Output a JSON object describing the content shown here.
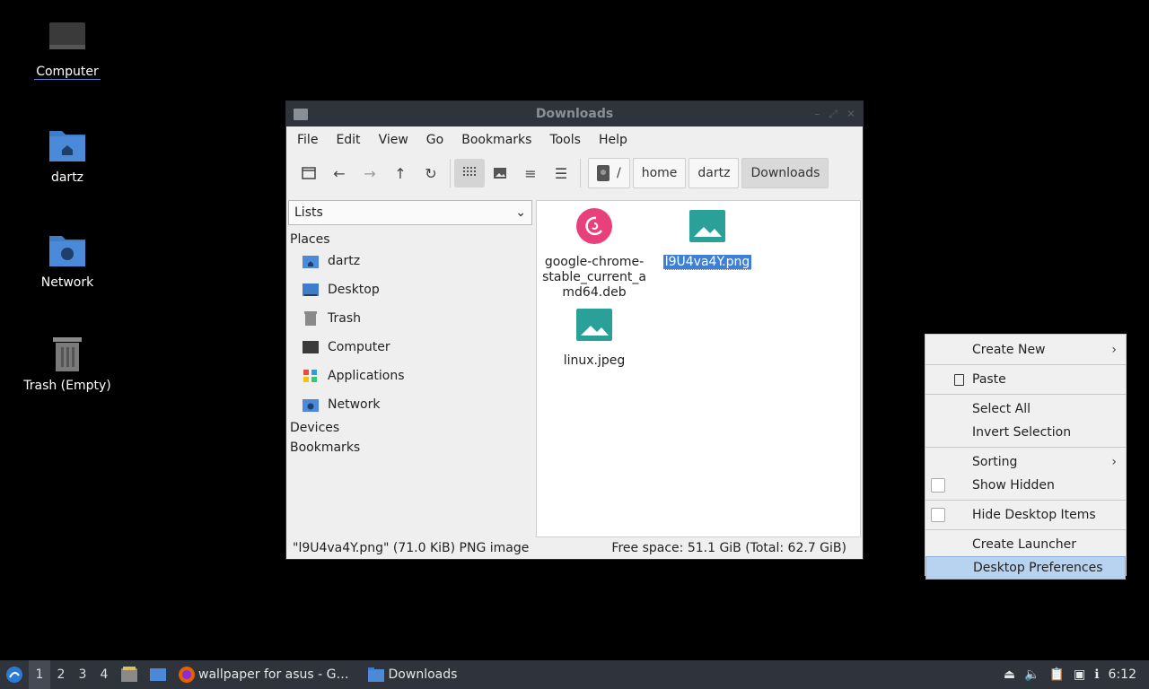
{
  "desktop": {
    "icons": [
      {
        "label": "Computer",
        "icon": "monitor-icon"
      },
      {
        "label": "dartz",
        "icon": "home-folder-icon"
      },
      {
        "label": "Network",
        "icon": "network-folder-icon"
      },
      {
        "label": "Trash (Empty)",
        "icon": "trash-icon"
      }
    ]
  },
  "window": {
    "title": "Downloads",
    "menu": [
      "File",
      "Edit",
      "View",
      "Go",
      "Bookmarks",
      "Tools",
      "Help"
    ],
    "breadcrumbs": [
      "/",
      "home",
      "dartz",
      "Downloads"
    ],
    "side_select": "Lists",
    "sections": {
      "places": "Places",
      "devices": "Devices",
      "bookmarks": "Bookmarks"
    },
    "places": [
      "dartz",
      "Desktop",
      "Trash",
      "Computer",
      "Applications",
      "Network"
    ],
    "files": [
      {
        "name": "google-chrome-stable_current_amd64.deb",
        "line1": "google-chrome-",
        "line2": "stable_current_a",
        "line3": "md64.deb",
        "icon": "debian-package-icon"
      },
      {
        "name": "l9U4va4Y.png",
        "icon": "image-icon",
        "selected": true
      },
      {
        "name": "linux.jpeg",
        "icon": "image-icon"
      }
    ],
    "status_left": "\"l9U4va4Y.png\" (71.0 KiB) PNG image",
    "status_right": "Free space: 51.1 GiB (Total: 62.7 GiB)"
  },
  "context_menu": {
    "create_new": "Create New",
    "paste": "Paste",
    "select_all": "Select All",
    "invert_selection": "Invert Selection",
    "sorting": "Sorting",
    "show_hidden": "Show Hidden",
    "hide_desktop_items": "Hide Desktop Items",
    "create_launcher": "Create Launcher",
    "desktop_preferences": "Desktop Preferences"
  },
  "taskbar": {
    "workspaces": [
      "1",
      "2",
      "3",
      "4"
    ],
    "tasks": [
      {
        "label": "wallpaper for asus - G…",
        "icon": "firefox-icon"
      },
      {
        "label": "Downloads",
        "icon": "folder-icon"
      }
    ],
    "clock": "6:12"
  },
  "colors": {
    "selection": "#3d80d6",
    "titlebar": "#2f343c",
    "folder_blue": "#4a8ad8",
    "image_teal": "#2aa198",
    "debian_red": "#e8407a"
  }
}
